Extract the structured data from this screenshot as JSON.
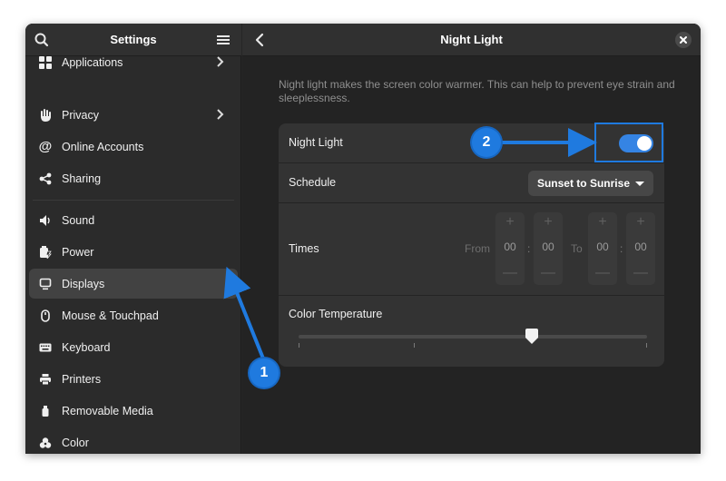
{
  "sidebar": {
    "title": "Settings",
    "items": [
      {
        "label": "Applications",
        "icon": "applications-icon",
        "has_chevron": true
      },
      {
        "label": "Privacy",
        "icon": "hand-icon",
        "has_chevron": true
      },
      {
        "label": "Online Accounts",
        "icon": "at-sign-icon"
      },
      {
        "label": "Sharing",
        "icon": "share-icon"
      },
      {
        "label": "Sound",
        "icon": "speaker-icon"
      },
      {
        "label": "Power",
        "icon": "battery-icon"
      },
      {
        "label": "Displays",
        "icon": "monitor-icon",
        "active": true
      },
      {
        "label": "Mouse & Touchpad",
        "icon": "mouse-icon"
      },
      {
        "label": "Keyboard",
        "icon": "keyboard-icon"
      },
      {
        "label": "Printers",
        "icon": "printer-icon"
      },
      {
        "label": "Removable Media",
        "icon": "usb-icon"
      },
      {
        "label": "Color",
        "icon": "color-icon"
      }
    ]
  },
  "main": {
    "title": "Night Light",
    "description": "Night light makes the screen color warmer. This can help to prevent eye strain and sleeplessness.",
    "night_light": {
      "label": "Night Light",
      "enabled": true
    },
    "schedule": {
      "label": "Schedule",
      "value": "Sunset to Sunrise"
    },
    "times": {
      "label": "Times",
      "from_label": "From",
      "to_label": "To",
      "from_hour": "00",
      "from_minute": "00",
      "to_hour": "00",
      "to_minute": "00",
      "plus": "+",
      "minus": "—",
      "colon": ":"
    },
    "color_temperature": {
      "label": "Color Temperature",
      "level": 0.67
    }
  },
  "annotations": {
    "badge_1": "1",
    "badge_2": "2",
    "color": "#1f7adf"
  },
  "colors": {
    "accent": "#3584e4",
    "window_bg": "#262626",
    "card_bg": "#333333"
  }
}
